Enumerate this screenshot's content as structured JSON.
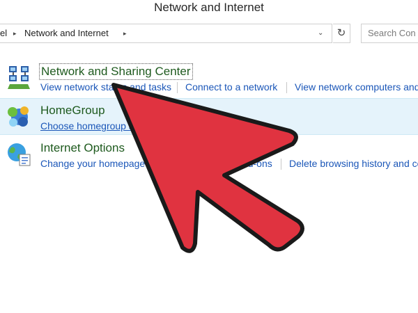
{
  "window": {
    "title": "Network and Internet"
  },
  "address": {
    "crumbs": [
      "el",
      "Network and Internet"
    ],
    "separator": "▸",
    "dropdown": "⌄",
    "refresh_icon": "↻"
  },
  "search": {
    "placeholder": "Search Con"
  },
  "categories": [
    {
      "title": "Network and Sharing Center",
      "icon": "network-sharing-icon",
      "links": [
        "View network status and tasks",
        "Connect to a network",
        "View network computers and"
      ]
    },
    {
      "title": "HomeGroup",
      "icon": "homegroup-icon",
      "links": [
        "Choose homegroup and sharing options"
      ]
    },
    {
      "title": "Internet Options",
      "icon": "internet-options-icon",
      "links": [
        "Change your homepage",
        "Manage browser add-ons",
        "Delete browsing history and co"
      ]
    }
  ],
  "overlay": {
    "type": "pointer-arrow",
    "fill": "#e03340",
    "stroke": "#1a1a1a"
  },
  "colors": {
    "category_title": "#1e5a1e",
    "link": "#1a56b8",
    "highlight": "#e5f3fb"
  }
}
